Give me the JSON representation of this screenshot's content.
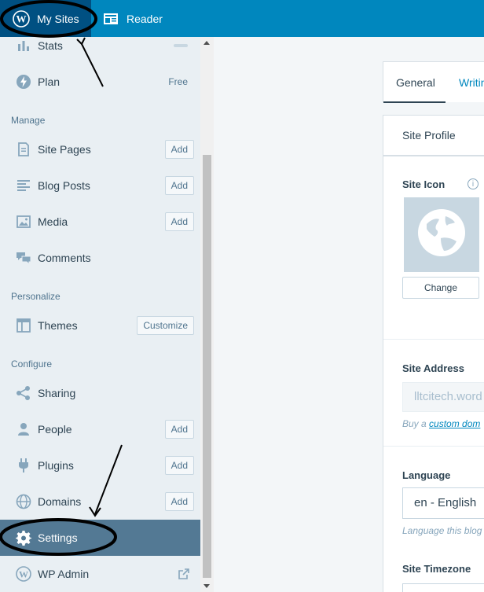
{
  "masterbar": {
    "my_sites_label": "My Sites",
    "reader_label": "Reader"
  },
  "sidebar": {
    "items": [
      {
        "label": "Stats",
        "icon": "stats-icon"
      },
      {
        "label": "Plan",
        "icon": "plan-icon",
        "right_text": "Free"
      },
      {
        "label": "Site Pages",
        "icon": "page-icon",
        "button": "Add"
      },
      {
        "label": "Blog Posts",
        "icon": "posts-icon",
        "button": "Add"
      },
      {
        "label": "Media",
        "icon": "media-icon",
        "button": "Add"
      },
      {
        "label": "Comments",
        "icon": "comments-icon"
      },
      {
        "label": "Themes",
        "icon": "themes-icon",
        "button": "Customize"
      },
      {
        "label": "Sharing",
        "icon": "share-icon"
      },
      {
        "label": "People",
        "icon": "people-icon",
        "button": "Add"
      },
      {
        "label": "Plugins",
        "icon": "plugin-icon",
        "button": "Add"
      },
      {
        "label": "Domains",
        "icon": "globe-icon",
        "button": "Add"
      },
      {
        "label": "Settings",
        "icon": "gear-icon",
        "selected": true
      },
      {
        "label": "WP Admin",
        "icon": "wordpress-icon",
        "external": true
      }
    ],
    "headings": {
      "manage": "Manage",
      "personalize": "Personalize",
      "configure": "Configure"
    }
  },
  "main": {
    "tabs": [
      {
        "label": "General",
        "active": true
      },
      {
        "label": "Writin"
      }
    ],
    "site_profile_title": "Site Profile",
    "site_icon_label": "Site Icon",
    "change_button": "Change",
    "site_address_label": "Site Address",
    "site_address_value": "lltcitech.word",
    "buy_domain_prefix": "Buy a ",
    "buy_domain_link": "custom dom",
    "language_label": "Language",
    "language_value": "en - English",
    "language_hint": "Language this blog",
    "timezone_label": "Site Timezone"
  },
  "colors": {
    "masterbar": "#0087be",
    "my_sites_active": "#005082",
    "sidebar_bg": "#e9eff3",
    "selected_item": "#537994",
    "link": "#0087be"
  }
}
